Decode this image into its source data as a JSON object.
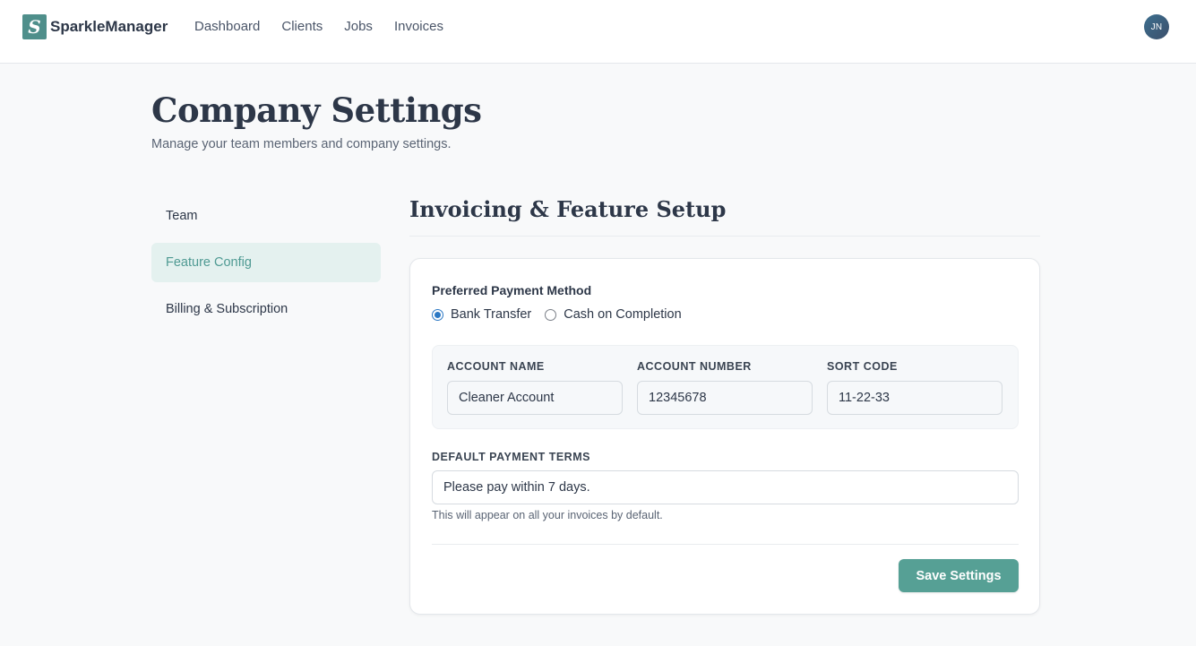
{
  "app": {
    "logo_letter": "S",
    "name": "SparkleManager"
  },
  "nav": {
    "items": [
      {
        "label": "Dashboard"
      },
      {
        "label": "Clients"
      },
      {
        "label": "Jobs"
      },
      {
        "label": "Invoices"
      }
    ]
  },
  "user": {
    "initials": "JN"
  },
  "page": {
    "title": "Company Settings",
    "subtitle": "Manage your team members and company settings."
  },
  "sidebar": {
    "items": [
      {
        "label": "Team",
        "active": false
      },
      {
        "label": "Feature Config",
        "active": true
      },
      {
        "label": "Billing & Subscription",
        "active": false
      }
    ]
  },
  "section": {
    "title": "Invoicing & Feature Setup"
  },
  "payment": {
    "label": "Preferred Payment Method",
    "options": [
      {
        "label": "Bank Transfer",
        "checked": true
      },
      {
        "label": "Cash on Completion",
        "checked": false
      }
    ],
    "bank": {
      "account_name": {
        "label": "ACCOUNT NAME",
        "value": "Cleaner Account"
      },
      "account_number": {
        "label": "ACCOUNT NUMBER",
        "value": "12345678"
      },
      "sort_code": {
        "label": "SORT CODE",
        "value": "11-22-33"
      }
    }
  },
  "terms": {
    "label": "DEFAULT PAYMENT TERMS",
    "value": "Please pay within 7 days.",
    "help": "This will appear on all your invoices by default."
  },
  "actions": {
    "save_label": "Save Settings"
  },
  "colors": {
    "accent": "#56a095",
    "active_bg": "#e4f1ef",
    "radio": "#2b78c4"
  }
}
